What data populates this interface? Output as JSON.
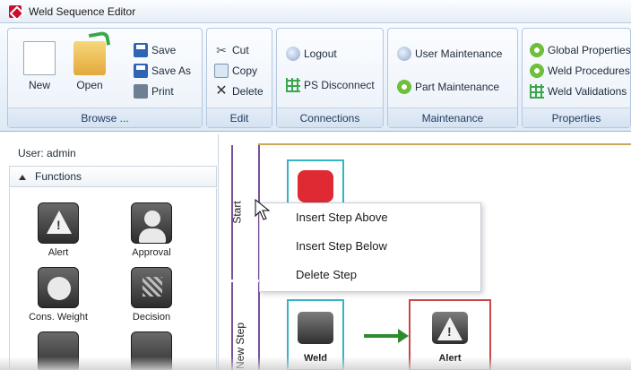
{
  "window": {
    "title": "Weld Sequence Editor",
    "accent": "#2f63b3",
    "brand": "#c8102e"
  },
  "ribbon": {
    "browse": {
      "new": "New",
      "open": "Open",
      "save": "Save",
      "save_as": "Save As",
      "print": "Print",
      "group": "Browse ..."
    },
    "edit": {
      "cut": "Cut",
      "copy": "Copy",
      "delete": "Delete",
      "group": "Edit"
    },
    "connections": {
      "logout": "Logout",
      "ps_disconnect": "PS Disconnect",
      "group": "Connections"
    },
    "maintenance": {
      "user": "User Maintenance",
      "part": "Part Maintenance",
      "group": "Maintenance"
    },
    "properties": {
      "global": "Global Properties",
      "procedures": "Weld Procedures",
      "validations": "Weld Validations",
      "group": "Properties"
    }
  },
  "left": {
    "user": "User: admin",
    "functions_header": "Functions",
    "tools": [
      {
        "label": "Alert",
        "icon": "alert-icon"
      },
      {
        "label": "Approval",
        "icon": "approval-icon"
      },
      {
        "label": "Cons. Weight",
        "icon": "scale-icon"
      },
      {
        "label": "Decision",
        "icon": "decision-icon"
      },
      {
        "label": "",
        "icon": "camera-icon"
      },
      {
        "label": "",
        "icon": "camera-icon"
      }
    ]
  },
  "canvas": {
    "lanes": [
      {
        "label": "Start"
      },
      {
        "label": "New Step"
      }
    ],
    "nodes": [
      {
        "label": "",
        "icon": "start-icon"
      },
      {
        "label": "Weld",
        "icon": "weld-icon"
      },
      {
        "label": "Alert",
        "icon": "alert-icon"
      }
    ]
  },
  "context_menu": {
    "items": [
      "Insert Step Above",
      "Insert Step Below",
      "Delete Step"
    ]
  }
}
